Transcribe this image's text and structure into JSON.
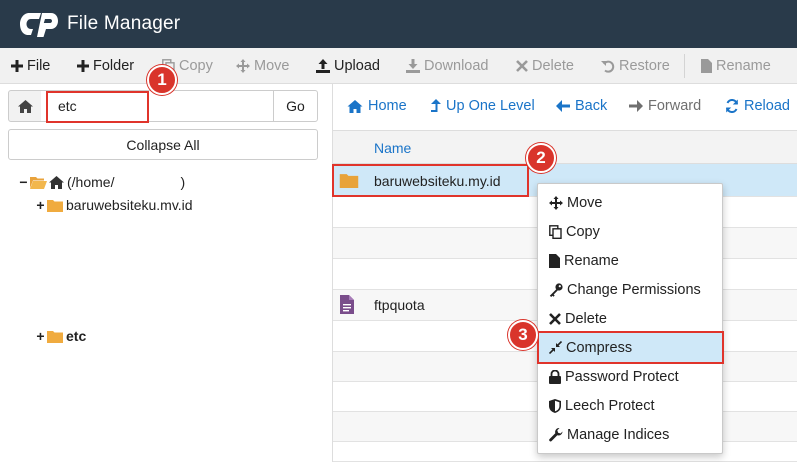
{
  "app": {
    "title": "File Manager",
    "colors": {
      "header": "#293a4a",
      "link": "#1a74c8",
      "annotation": "#d9342b",
      "selected_row": "#cfe8f8"
    }
  },
  "toolbar": {
    "file": "File",
    "folder": "Folder",
    "copy": "Copy",
    "move": "Move",
    "upload": "Upload",
    "download": "Download",
    "delete": "Delete",
    "restore": "Restore",
    "rename": "Rename"
  },
  "left_panel": {
    "path_value": "etc",
    "go_label": "Go",
    "collapse_label": "Collapse All",
    "tree": {
      "root": "(/home/",
      "root_close": ")",
      "child": "baruwebsiteku.mv.id",
      "etc": "etc"
    }
  },
  "navigation": {
    "home": "Home",
    "up_one_level": "Up One Level",
    "back": "Back",
    "forward": "Forward",
    "reload": "Reload"
  },
  "file_list": {
    "column_name": "Name",
    "rows": [
      {
        "name": "baruwebsiteku.my.id",
        "type": "folder-icon"
      },
      {
        "name": "ftpquota",
        "type": "file-icon"
      }
    ]
  },
  "context_menu": {
    "items": [
      {
        "label": "Move",
        "icon": "move-icon"
      },
      {
        "label": "Copy",
        "icon": "copy-icon"
      },
      {
        "label": "Rename",
        "icon": "file-icon"
      },
      {
        "label": "Change Permissions",
        "icon": "key-icon"
      },
      {
        "label": "Delete",
        "icon": "close-icon"
      },
      {
        "label": "Compress",
        "icon": "compress-icon"
      },
      {
        "label": "Password Protect",
        "icon": "lock-icon"
      },
      {
        "label": "Leech Protect",
        "icon": "shield-icon"
      },
      {
        "label": "Manage Indices",
        "icon": "wrench-icon"
      }
    ]
  },
  "annotations": {
    "step1": "1",
    "step2": "2",
    "step3": "3"
  }
}
